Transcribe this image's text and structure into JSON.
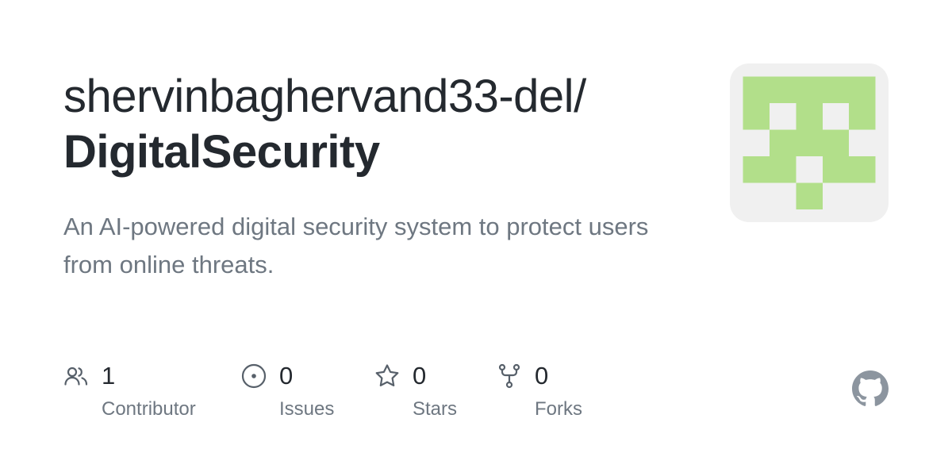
{
  "repo": {
    "owner_text": "shervinbaghervand33-del/",
    "name": "DigitalSecurity",
    "description": "An AI-powered digital security system to protect users from online threats."
  },
  "avatar": {
    "icon": "identicon",
    "foreground_color": "#b2df8a",
    "background_color": "#f0f0f0"
  },
  "stats": {
    "contributors": {
      "value": "1",
      "label": "Contributor",
      "icon": "people-icon"
    },
    "issues": {
      "value": "0",
      "label": "Issues",
      "icon": "issue-opened-icon"
    },
    "stars": {
      "value": "0",
      "label": "Stars",
      "icon": "star-icon"
    },
    "forks": {
      "value": "0",
      "label": "Forks",
      "icon": "repo-forked-icon"
    }
  },
  "brand": {
    "logo": "github-mark-icon",
    "logo_color": "#8c959f"
  },
  "colors": {
    "title": "#24292f",
    "muted": "#6e7781",
    "icon": "#57606a"
  }
}
